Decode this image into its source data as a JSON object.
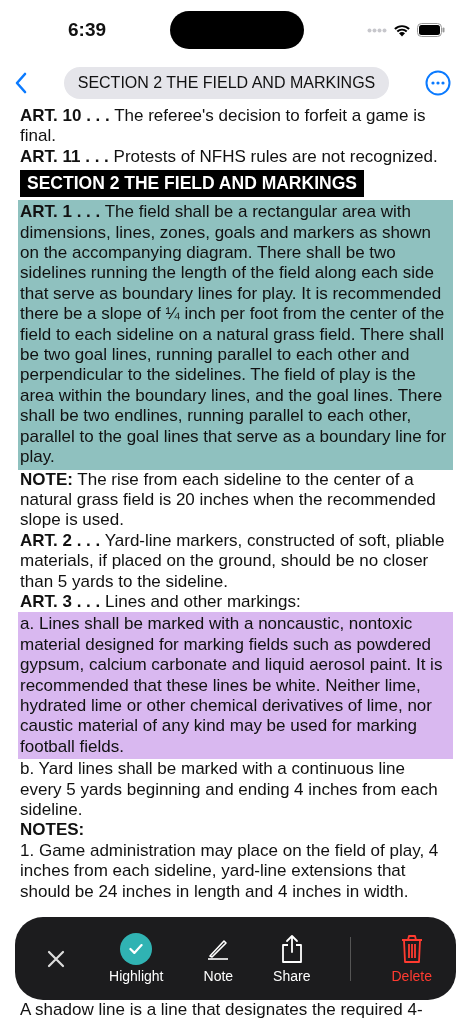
{
  "status_bar": {
    "time": "6:39"
  },
  "nav": {
    "title": "SECTION 2 THE FIELD AND MARKINGS"
  },
  "content": [
    {
      "kind": "article",
      "label": "ART. 10 . . .",
      "text": "The referee's decision to forfeit a game is final."
    },
    {
      "kind": "article",
      "label": "ART. 11 . . .",
      "text": "Protests of NFHS rules are not recognized."
    },
    {
      "kind": "heading",
      "text": "SECTION 2 THE FIELD AND MARKINGS"
    },
    {
      "kind": "article",
      "label": "ART. 1 . . .",
      "text": "The field shall be a rectangular area with dimensions, lines, zones, goals and markers as shown on the accompanying diagram. There shall be two sidelines running the length of the field along each side that serve as boundary lines for play. It is recommended there be a slope of ¼ inch per foot from the center of the field to each sideline on a natural grass field. There shall be two goal lines, running parallel to each other and perpendicular to the sidelines. The field of play is the area within the boundary lines, and the goal lines. There shall be two endlines, running parallel to each other, parallel to the goal lines that serve as a boundary line for play.",
      "color": "#8fc1bf"
    },
    {
      "kind": "note",
      "label": "NOTE:",
      "text": "The rise from each sideline to the center of a natural grass field is 20 inches when the recommended slope is used."
    },
    {
      "kind": "article",
      "label": "ART. 2 . . .",
      "text": "Yard-line markers, constructed of soft, pliable materials, if placed on the ground, should be no closer than 5 yards to the sideline."
    },
    {
      "kind": "article",
      "label": "ART. 3 . . .",
      "text": "Lines and other markings:"
    },
    {
      "kind": "item",
      "label": "a.",
      "text": "Lines shall be marked with a noncaustic, nontoxic material designed for marking fields such as powdered gypsum, calcium carbonate and liquid aerosol paint. It is recommended that these lines be white. Neither lime, hydrated lime or other chemical derivatives of lime, nor caustic material of any kind may be used for marking football fields.",
      "color": "#d9b8f0"
    },
    {
      "kind": "item",
      "label": "b.",
      "text": "Yard lines shall be marked with a continuous line every 5 yards beginning and ending 4 inches from each sideline."
    },
    {
      "kind": "subhead",
      "text": "NOTES:"
    },
    {
      "kind": "item",
      "label": "1.",
      "text": "Game administration may place on the field of play, 4 inches from each sideline, yard-line extensions that should be 24 inches in length and 4 inches in width."
    },
    {
      "kind": "plain",
      "text": "A shadow line is a line that designates the required 4-"
    }
  ],
  "toolbar": [
    {
      "kind": "close"
    },
    {
      "kind": "highlight",
      "label": "Highlight",
      "selected": true
    },
    {
      "kind": "note",
      "label": "Note",
      "selected": false
    },
    {
      "kind": "share",
      "label": "Share",
      "selected": false
    },
    {
      "kind": "delete",
      "label": "Delete",
      "selected": false
    }
  ]
}
